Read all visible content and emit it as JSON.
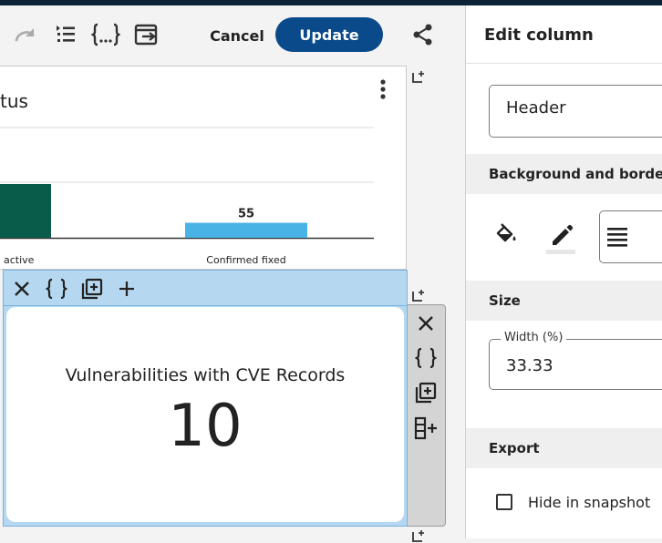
{
  "toolbar": {
    "cancel_label": "Cancel",
    "update_label": "Update",
    "icons": [
      "redo-icon",
      "outline-list-icon",
      "json-braces-icon",
      "export-icon",
      "share-icon"
    ],
    "accent_color": "#0a4a8a"
  },
  "chart_card": {
    "title_fragment": "tus",
    "chart_data": {
      "type": "bar",
      "categories": [
        "active",
        "Confirmed fixed"
      ],
      "values": [
        null,
        55
      ],
      "data_labels": [
        "",
        "55"
      ],
      "series_colors": [
        "#0a5c4a",
        "#4ab3e6"
      ]
    }
  },
  "kpi_card": {
    "label": "Vulnerabilities with CVE Records",
    "value": "10"
  },
  "panel": {
    "title": "Edit column",
    "header_value": "Header",
    "background_section": "Background and border",
    "size_section": "Size",
    "width_label": "Width (%)",
    "width_value": "33.33",
    "export_section": "Export",
    "hide_snapshot_label": "Hide in snapshot",
    "hide_snapshot_checked": false
  }
}
